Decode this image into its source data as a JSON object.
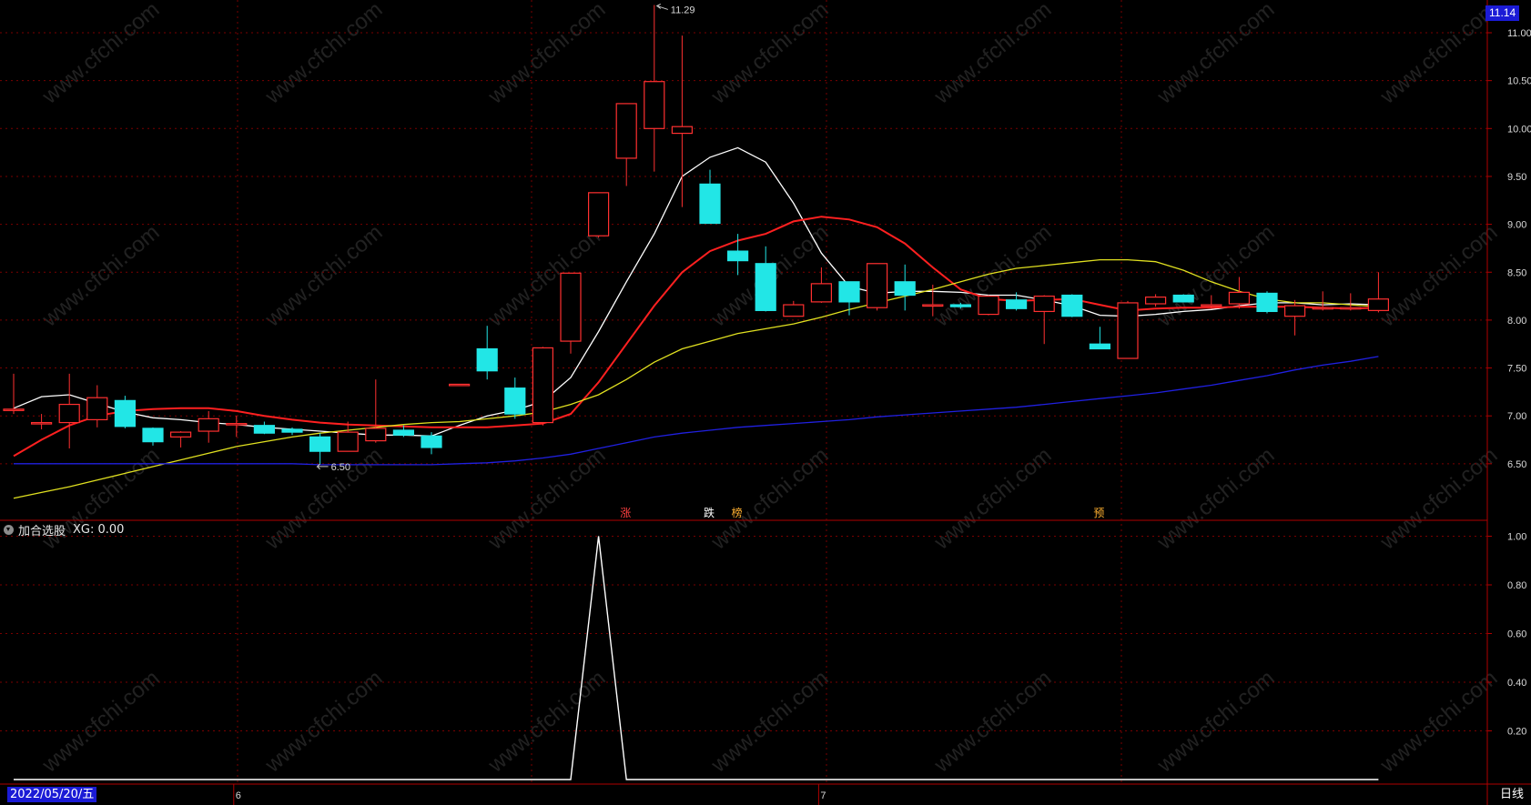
{
  "chart_data": [
    {
      "type": "candlestick",
      "title": "",
      "y_range": [
        6.0,
        11.45
      ],
      "y_ticks": [
        "11.00",
        "10.50",
        "10.00",
        "9.50",
        "9.00",
        "8.50",
        "8.00",
        "7.50",
        "7.00",
        "6.50"
      ],
      "current_price_label": "11.14",
      "month_labels": [
        {
          "index": 8,
          "label": "6"
        },
        {
          "index": 29,
          "label": "7"
        }
      ],
      "max_annotation": {
        "index": 23,
        "label": "11.29"
      },
      "min_annotation": {
        "index": 11,
        "label": "6.50"
      },
      "signals": [
        {
          "index": 22,
          "label": "涨",
          "color": "#ff4040"
        },
        {
          "index": 25,
          "label": "跌",
          "color": "#ffffff"
        },
        {
          "index": 26,
          "label": "榜",
          "color": "#ffb030"
        },
        {
          "index": 39,
          "label": "预",
          "color": "#ffb030"
        }
      ],
      "candles": [
        {
          "o": 7.07,
          "h": 7.44,
          "l": 7.02,
          "c": 7.07
        },
        {
          "o": 6.93,
          "h": 7.02,
          "l": 6.86,
          "c": 6.93
        },
        {
          "o": 6.93,
          "h": 7.44,
          "l": 6.66,
          "c": 7.12
        },
        {
          "o": 6.96,
          "h": 7.32,
          "l": 6.88,
          "c": 7.19
        },
        {
          "o": 7.16,
          "h": 7.21,
          "l": 6.87,
          "c": 6.89
        },
        {
          "o": 6.87,
          "h": 6.88,
          "l": 6.69,
          "c": 6.73
        },
        {
          "o": 6.78,
          "h": 6.84,
          "l": 6.67,
          "c": 6.83
        },
        {
          "o": 6.84,
          "h": 7.05,
          "l": 6.72,
          "c": 6.97
        },
        {
          "o": 6.92,
          "h": 7.0,
          "l": 6.78,
          "c": 6.92
        },
        {
          "o": 6.9,
          "h": 6.94,
          "l": 6.81,
          "c": 6.82
        },
        {
          "o": 6.86,
          "h": 6.88,
          "l": 6.8,
          "c": 6.83
        },
        {
          "o": 6.78,
          "h": 6.82,
          "l": 6.5,
          "c": 6.63
        },
        {
          "o": 6.63,
          "h": 6.94,
          "l": 6.63,
          "c": 6.83
        },
        {
          "o": 6.74,
          "h": 7.38,
          "l": 6.72,
          "c": 6.87
        },
        {
          "o": 6.85,
          "h": 6.9,
          "l": 6.78,
          "c": 6.8
        },
        {
          "o": 6.79,
          "h": 6.83,
          "l": 6.6,
          "c": 6.67
        },
        {
          "o": 7.33,
          "h": 7.33,
          "l": 7.33,
          "c": 7.33
        },
        {
          "o": 7.7,
          "h": 7.94,
          "l": 7.38,
          "c": 7.47
        },
        {
          "o": 7.29,
          "h": 7.4,
          "l": 6.97,
          "c": 7.02
        },
        {
          "o": 6.93,
          "h": 7.72,
          "l": 6.9,
          "c": 7.71
        },
        {
          "o": 7.78,
          "h": 8.49,
          "l": 7.65,
          "c": 8.49
        },
        {
          "o": 8.88,
          "h": 9.33,
          "l": 8.86,
          "c": 9.33
        },
        {
          "o": 9.69,
          "h": 10.26,
          "l": 9.4,
          "c": 10.26
        },
        {
          "o": 10.0,
          "h": 11.29,
          "l": 9.55,
          "c": 10.49
        },
        {
          "o": 9.95,
          "h": 10.97,
          "l": 9.18,
          "c": 10.02
        },
        {
          "o": 9.42,
          "h": 9.57,
          "l": 9.01,
          "c": 9.01
        },
        {
          "o": 8.72,
          "h": 8.9,
          "l": 8.47,
          "c": 8.62
        },
        {
          "o": 8.59,
          "h": 8.77,
          "l": 8.09,
          "c": 8.1
        },
        {
          "o": 8.04,
          "h": 8.2,
          "l": 8.04,
          "c": 8.16
        },
        {
          "o": 8.19,
          "h": 8.55,
          "l": 8.18,
          "c": 8.38
        },
        {
          "o": 8.4,
          "h": 8.4,
          "l": 8.05,
          "c": 8.19
        },
        {
          "o": 8.13,
          "h": 8.59,
          "l": 8.1,
          "c": 8.59
        },
        {
          "o": 8.4,
          "h": 8.58,
          "l": 8.1,
          "c": 8.26
        },
        {
          "o": 8.16,
          "h": 8.37,
          "l": 8.04,
          "c": 8.16
        },
        {
          "o": 8.16,
          "h": 8.18,
          "l": 8.12,
          "c": 8.14
        },
        {
          "o": 8.06,
          "h": 8.26,
          "l": 8.05,
          "c": 8.25
        },
        {
          "o": 8.21,
          "h": 8.29,
          "l": 8.1,
          "c": 8.12
        },
        {
          "o": 8.09,
          "h": 8.26,
          "l": 7.75,
          "c": 8.25
        },
        {
          "o": 8.26,
          "h": 8.27,
          "l": 8.03,
          "c": 8.04
        },
        {
          "o": 7.75,
          "h": 7.93,
          "l": 7.71,
          "c": 7.7
        },
        {
          "o": 7.6,
          "h": 8.2,
          "l": 7.6,
          "c": 8.18
        },
        {
          "o": 8.17,
          "h": 8.27,
          "l": 8.14,
          "c": 8.24
        },
        {
          "o": 8.26,
          "h": 8.27,
          "l": 8.19,
          "c": 8.19
        },
        {
          "o": 8.16,
          "h": 8.26,
          "l": 8.12,
          "c": 8.16
        },
        {
          "o": 8.17,
          "h": 8.45,
          "l": 8.12,
          "c": 8.29
        },
        {
          "o": 8.28,
          "h": 8.3,
          "l": 8.07,
          "c": 8.09
        },
        {
          "o": 8.04,
          "h": 8.21,
          "l": 7.84,
          "c": 8.15
        },
        {
          "o": 8.13,
          "h": 8.3,
          "l": 8.1,
          "c": 8.13
        },
        {
          "o": 8.13,
          "h": 8.28,
          "l": 8.1,
          "c": 8.13
        },
        {
          "o": 8.1,
          "h": 8.5,
          "l": 8.08,
          "c": 8.22
        }
      ],
      "moving_averages": [
        {
          "color": "#ffffff",
          "values": [
            7.08,
            7.2,
            7.22,
            7.13,
            7.04,
            6.98,
            6.96,
            6.93,
            6.91,
            6.88,
            6.86,
            6.84,
            6.82,
            6.8,
            6.8,
            6.79,
            6.9,
            7.0,
            7.06,
            7.15,
            7.4,
            7.88,
            8.4,
            8.9,
            9.5,
            9.7,
            9.8,
            9.65,
            9.22,
            8.7,
            8.35,
            8.28,
            8.3,
            8.3,
            8.29,
            8.26,
            8.26,
            8.21,
            8.15,
            8.05,
            8.04,
            8.06,
            8.09,
            8.11,
            8.15,
            8.18,
            8.18,
            8.16,
            8.17,
            8.16
          ]
        },
        {
          "color": "#ff2020",
          "values": [
            6.58,
            6.75,
            6.9,
            7.0,
            7.05,
            7.07,
            7.08,
            7.08,
            7.05,
            7.0,
            6.96,
            6.93,
            6.91,
            6.9,
            6.89,
            6.88,
            6.88,
            6.88,
            6.9,
            6.92,
            7.02,
            7.35,
            7.75,
            8.15,
            8.5,
            8.72,
            8.83,
            8.9,
            9.03,
            9.08,
            9.05,
            8.97,
            8.8,
            8.55,
            8.32,
            8.22,
            8.2,
            8.21,
            8.22,
            8.16,
            8.1,
            8.12,
            8.13,
            8.13,
            8.14,
            8.14,
            8.14,
            8.13,
            8.12,
            8.13
          ]
        },
        {
          "color": "#e0e020",
          "values": [
            6.14,
            6.2,
            6.26,
            6.33,
            6.4,
            6.47,
            6.54,
            6.61,
            6.68,
            6.73,
            6.78,
            6.82,
            6.85,
            6.88,
            6.91,
            6.93,
            6.94,
            6.97,
            7.0,
            7.04,
            7.12,
            7.22,
            7.38,
            7.56,
            7.7,
            7.78,
            7.86,
            7.91,
            7.96,
            8.03,
            8.11,
            8.18,
            8.25,
            8.32,
            8.4,
            8.48,
            8.54,
            8.57,
            8.6,
            8.63,
            8.63,
            8.61,
            8.52,
            8.4,
            8.3,
            8.22,
            8.18,
            8.18,
            8.16,
            8.14
          ]
        },
        {
          "color": "#2020e0",
          "values": [
            6.5,
            6.5,
            6.5,
            6.5,
            6.5,
            6.5,
            6.5,
            6.5,
            6.5,
            6.5,
            6.5,
            6.49,
            6.49,
            6.49,
            6.49,
            6.49,
            6.5,
            6.51,
            6.53,
            6.56,
            6.6,
            6.66,
            6.72,
            6.78,
            6.82,
            6.85,
            6.88,
            6.9,
            6.92,
            6.94,
            6.96,
            6.99,
            7.01,
            7.03,
            7.05,
            7.07,
            7.09,
            7.12,
            7.15,
            7.18,
            7.21,
            7.24,
            7.28,
            7.32,
            7.37,
            7.42,
            7.48,
            7.53,
            7.57,
            7.62
          ]
        }
      ]
    },
    {
      "type": "line",
      "indicator_name": "加合选股",
      "indicator_value_label": "XG: 0.00",
      "y_range": [
        0,
        1.05
      ],
      "y_ticks": [
        "1.00",
        "0.80",
        "0.60",
        "0.40",
        "0.20"
      ],
      "date_label": "2022/05/20/五",
      "period_label": "日线",
      "values": [
        0,
        0,
        0,
        0,
        0,
        0,
        0,
        0,
        0,
        0,
        0,
        0,
        0,
        0,
        0,
        0,
        0,
        0,
        0,
        0,
        0,
        1,
        0,
        0,
        0,
        0,
        0,
        0,
        0,
        0,
        0,
        0,
        0,
        0,
        0,
        0,
        0,
        0,
        0,
        0,
        0,
        0,
        0,
        0,
        0,
        0,
        0,
        0,
        0,
        0
      ]
    }
  ],
  "watermark": "www.cfchi.com",
  "colors": {
    "up": "#ff3030",
    "down": "#22e6e6",
    "grid": "#7a0000",
    "axis": "#b00000"
  }
}
